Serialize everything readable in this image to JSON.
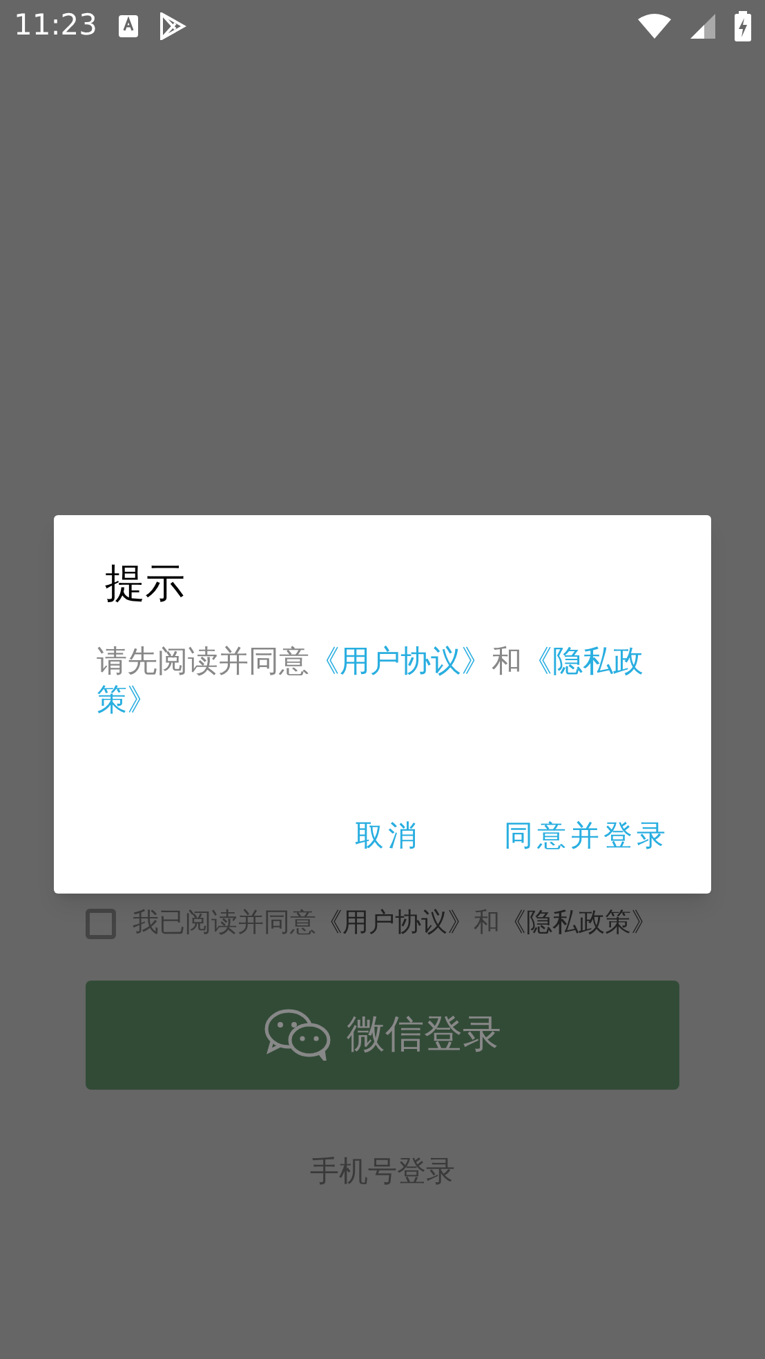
{
  "status_bar": {
    "time": "11:23"
  },
  "agreement": {
    "checked": false,
    "parts": [
      {
        "kind": "text",
        "text": "我已阅读并同意"
      },
      {
        "kind": "link",
        "text": "《用户协议》"
      },
      {
        "kind": "text",
        "text": "和"
      },
      {
        "kind": "link",
        "text": "《隐私政策》"
      }
    ]
  },
  "wechat_button": {
    "label": "微信登录"
  },
  "phone_login": {
    "label": "手机号登录"
  },
  "dialog": {
    "title": "提示",
    "message": [
      {
        "kind": "text",
        "text": "请先阅读并同意"
      },
      {
        "kind": "link",
        "text": "《用户协议》"
      },
      {
        "kind": "text",
        "text": "和"
      },
      {
        "kind": "link",
        "text": "《隐私政策》"
      }
    ],
    "buttons": [
      "取消",
      "同意并登录"
    ]
  }
}
